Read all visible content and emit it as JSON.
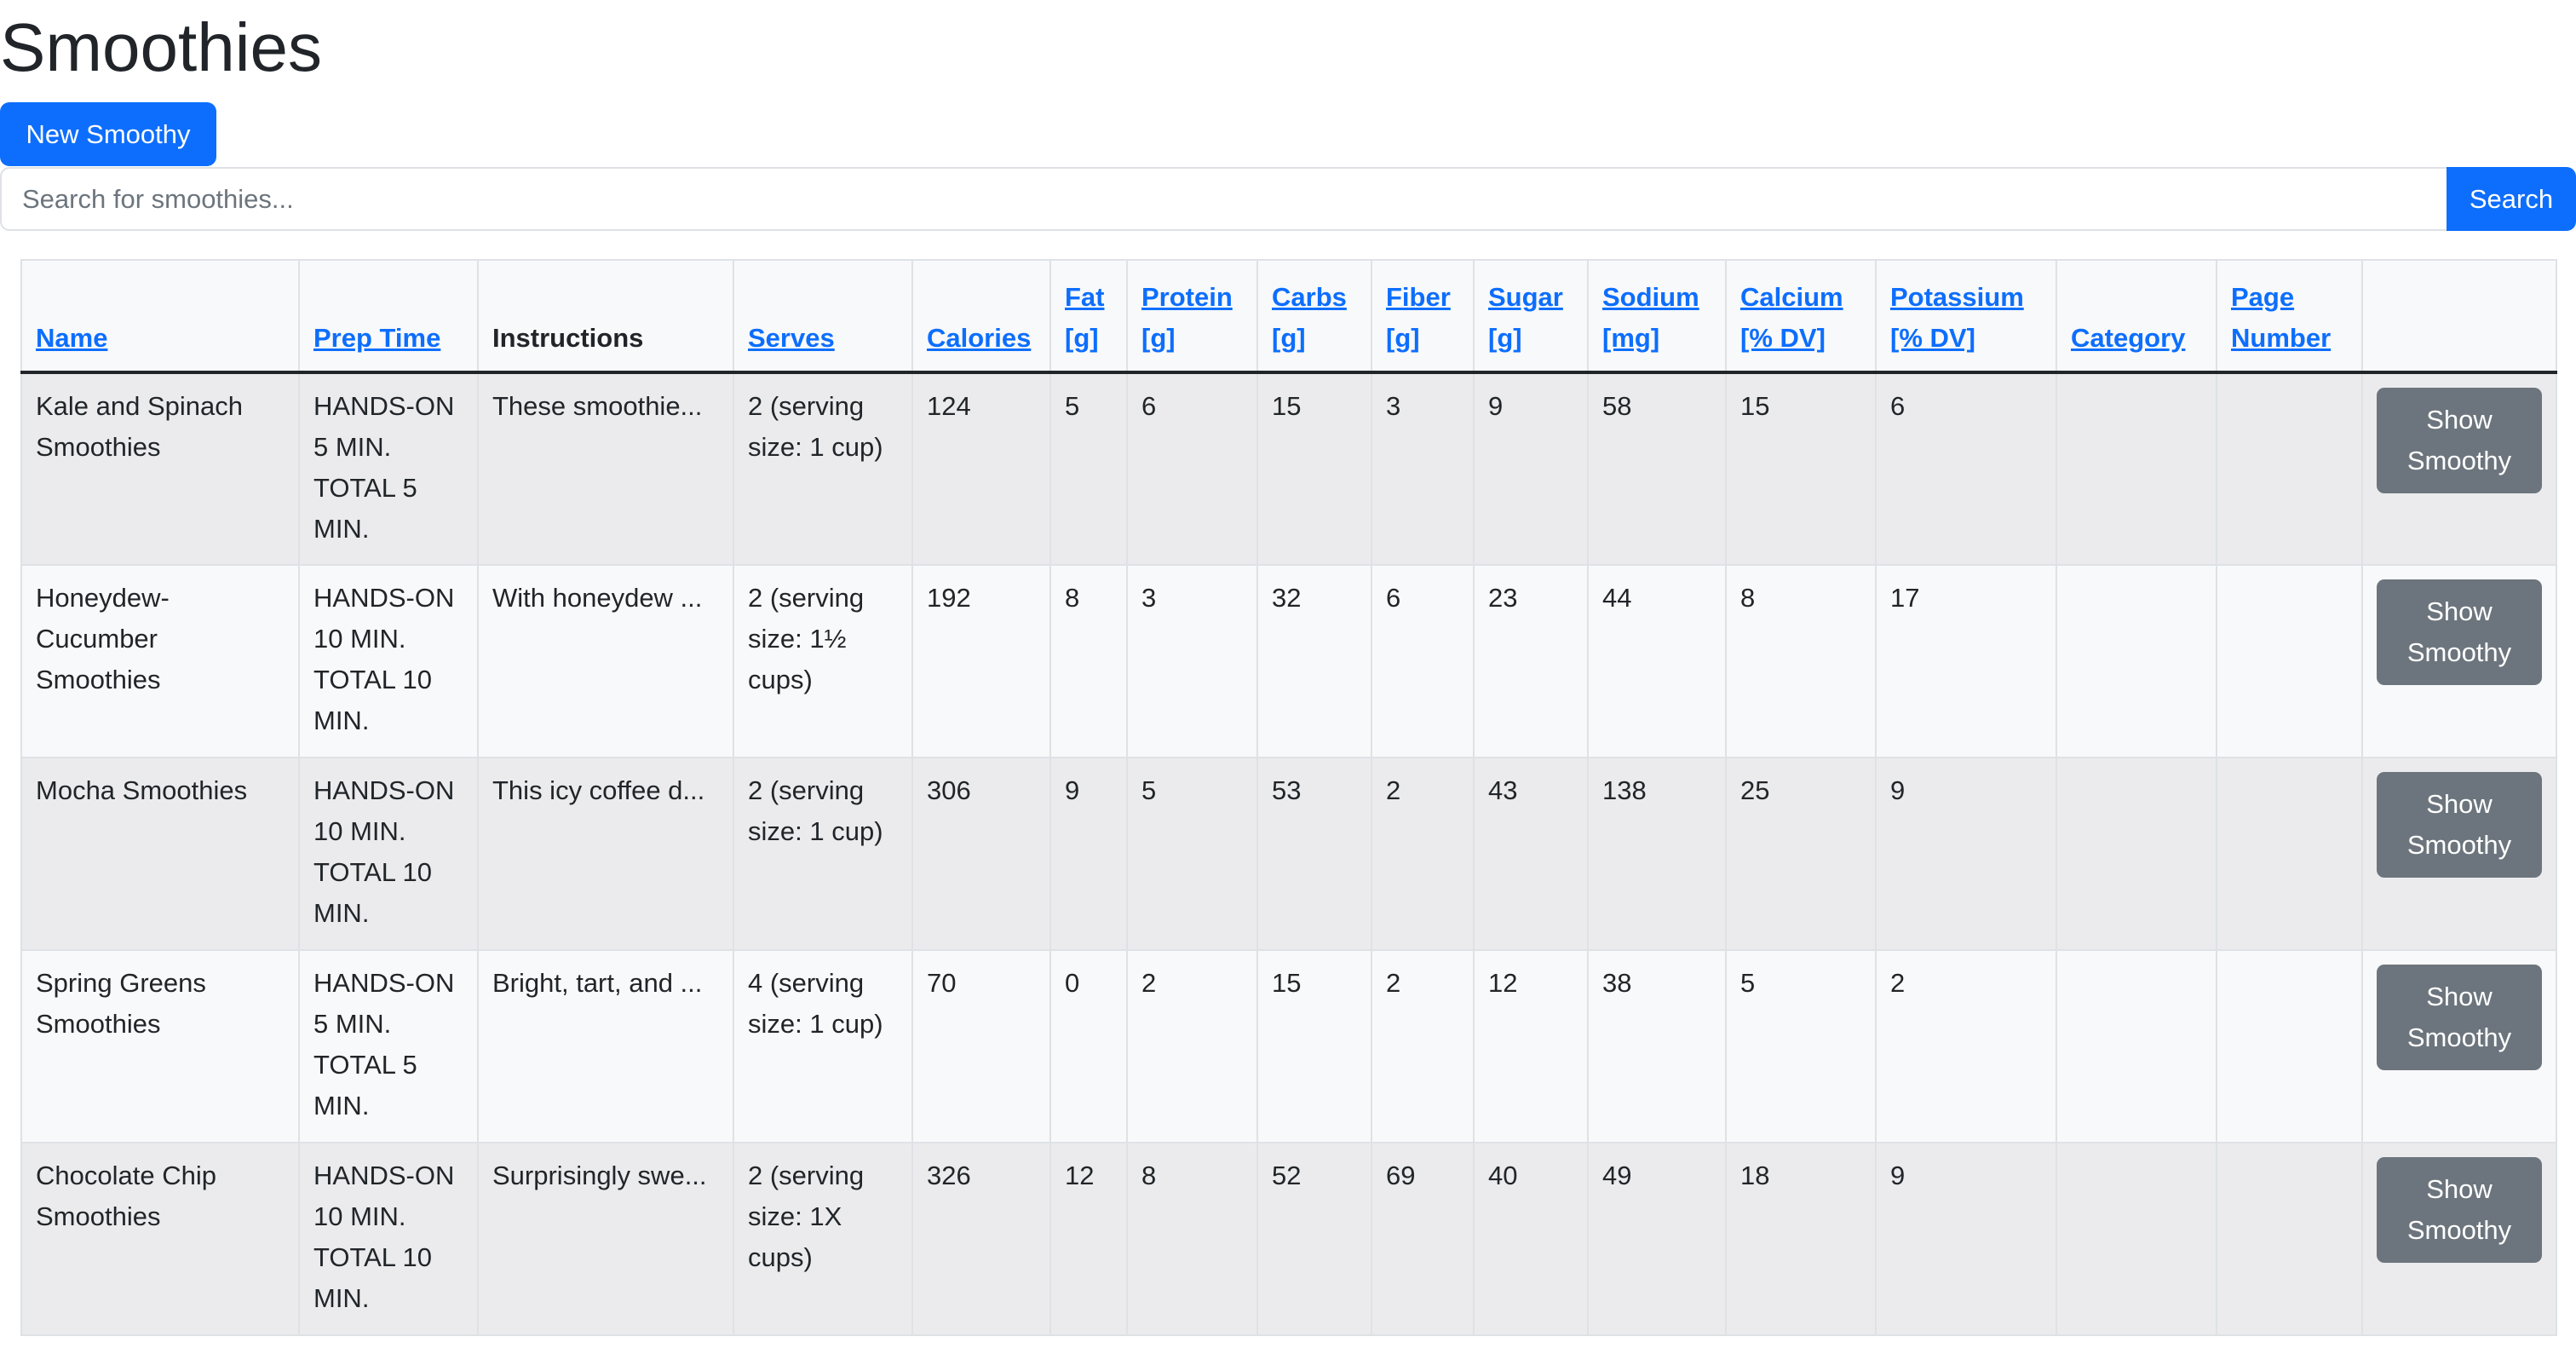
{
  "page": {
    "title": "Smoothies"
  },
  "toolbar": {
    "new_label": "New Smoothy"
  },
  "search": {
    "placeholder": "Search for smoothies...",
    "value": "",
    "button_label": "Search"
  },
  "table": {
    "headers": [
      {
        "label": "Name",
        "sortable": true
      },
      {
        "label": "Prep Time",
        "sortable": true
      },
      {
        "label": "Instructions",
        "sortable": false
      },
      {
        "label": "Serves",
        "sortable": true
      },
      {
        "label": "Calories",
        "sortable": true
      },
      {
        "label": "Fat [g]",
        "sortable": true
      },
      {
        "label": "Protein [g]",
        "sortable": true
      },
      {
        "label": "Carbs [g]",
        "sortable": true
      },
      {
        "label": "Fiber [g]",
        "sortable": true
      },
      {
        "label": "Sugar [g]",
        "sortable": true
      },
      {
        "label": "Sodium [mg]",
        "sortable": true
      },
      {
        "label": "Calcium [% DV]",
        "sortable": true
      },
      {
        "label": "Potassium [% DV]",
        "sortable": true
      },
      {
        "label": "Category",
        "sortable": true
      },
      {
        "label": "Page Number",
        "sortable": true
      },
      {
        "label": "",
        "sortable": false
      }
    ],
    "rows": [
      {
        "name": "Kale and Spinach Smoothies",
        "prep_time": "HANDS-ON 5 MIN. TOTAL 5 MIN.",
        "instructions": "These smoothie...",
        "serves": "2 (serving size: 1 cup)",
        "calories": "124",
        "fat": "5",
        "protein": "6",
        "carbs": "15",
        "fiber": "3",
        "sugar": "9",
        "sodium": "58",
        "calcium": "15",
        "potassium": "6",
        "category": "",
        "page_number": "",
        "action_label": "Show Smoothy"
      },
      {
        "name": "Honeydew-Cucumber Smoothies",
        "prep_time": "HANDS-ON 10 MIN. TOTAL 10 MIN.",
        "instructions": "With honeydew ...",
        "serves": "2 (serving size: 1½ cups)",
        "calories": "192",
        "fat": "8",
        "protein": "3",
        "carbs": "32",
        "fiber": "6",
        "sugar": "23",
        "sodium": "44",
        "calcium": "8",
        "potassium": "17",
        "category": "",
        "page_number": "",
        "action_label": "Show Smoothy"
      },
      {
        "name": "Mocha Smoothies",
        "prep_time": "HANDS-ON 10 MIN. TOTAL 10 MIN.",
        "instructions": "This icy coffee d...",
        "serves": "2 (serving size: 1 cup)",
        "calories": "306",
        "fat": "9",
        "protein": "5",
        "carbs": "53",
        "fiber": "2",
        "sugar": "43",
        "sodium": "138",
        "calcium": "25",
        "potassium": "9",
        "category": "",
        "page_number": "",
        "action_label": "Show Smoothy"
      },
      {
        "name": "Spring Greens Smoothies",
        "prep_time": "HANDS-ON 5 MIN. TOTAL 5 MIN.",
        "instructions": "Bright, tart, and ...",
        "serves": "4 (serving size: 1 cup)",
        "calories": "70",
        "fat": "0",
        "protein": "2",
        "carbs": "15",
        "fiber": "2",
        "sugar": "12",
        "sodium": "38",
        "calcium": "5",
        "potassium": "2",
        "category": "",
        "page_number": "",
        "action_label": "Show Smoothy"
      },
      {
        "name": "Chocolate Chip Smoothies",
        "prep_time": "HANDS-ON 10 MIN. TOTAL 10 MIN.",
        "instructions": "Surprisingly swe...",
        "serves": "2 (serving size: 1X cups)",
        "calories": "326",
        "fat": "12",
        "protein": "8",
        "carbs": "52",
        "fiber": "69",
        "sugar": "40",
        "sodium": "49",
        "calcium": "18",
        "potassium": "9",
        "category": "",
        "page_number": "",
        "action_label": "Show Smoothy"
      }
    ]
  },
  "colors": {
    "primary": "#0d6efd",
    "secondary": "#6c757d",
    "text": "#212529",
    "row_odd": "#ebebed",
    "row_even": "#f8f9fa",
    "border": "#dee2e6"
  }
}
